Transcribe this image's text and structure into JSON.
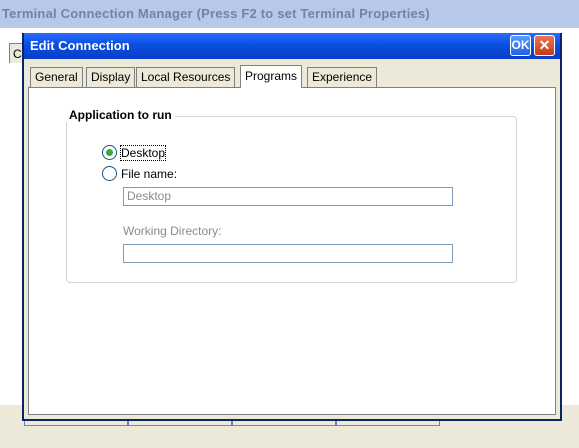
{
  "background_window": {
    "title": "Terminal Connection Manager (Press F2 to set Terminal Properties)",
    "tab_partial": "C"
  },
  "dialog": {
    "title": "Edit Connection",
    "ok_label": "OK",
    "close_label": "✕"
  },
  "tabs": [
    {
      "label": "General"
    },
    {
      "label": "Display"
    },
    {
      "label": "Local Resources"
    },
    {
      "label": "Programs"
    },
    {
      "label": "Experience"
    }
  ],
  "active_tab": "Programs",
  "programs": {
    "group_label": "Application to run",
    "options": [
      {
        "label": "Desktop",
        "selected": true
      },
      {
        "label": "File name:",
        "selected": false
      }
    ],
    "file_name_value": "Desktop",
    "working_directory_label": "Working Directory:",
    "working_directory_value": ""
  },
  "colors": {
    "titlebar": "#0a4ee0",
    "dialog_face": "#ece9d8",
    "radio_selected": "#3aa83a"
  }
}
